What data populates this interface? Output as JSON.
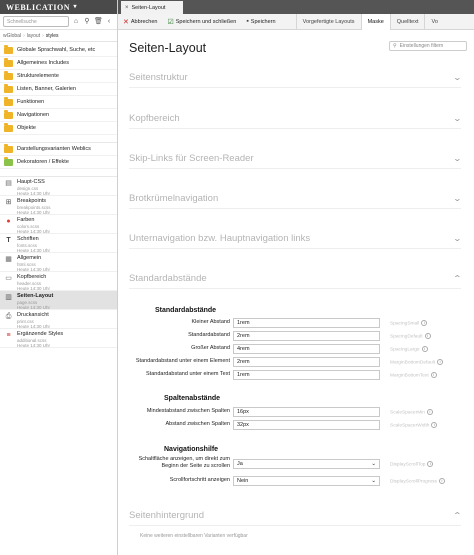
{
  "brand": {
    "name": "WEBLICATION"
  },
  "sidebar": {
    "search_placeholder": "Schnellsuche",
    "breadcrumb": [
      "wGlobal",
      "layout",
      "styles"
    ],
    "folders": [
      {
        "label": "Globale Sprachwahl, Suche, etc"
      },
      {
        "label": "Allgemeines Includes"
      },
      {
        "label": "Strukturelemente"
      },
      {
        "label": "Listen, Banner, Galerien"
      },
      {
        "label": "Funktionen"
      },
      {
        "label": "Navigationen"
      },
      {
        "label": "Objekte"
      },
      {
        "label": "Darstellungsvarianten Weblics"
      },
      {
        "label": "Dekoratoren / Effekte"
      }
    ],
    "files": [
      {
        "name": "Haupt-CSS",
        "file": "design.css",
        "date": "Heute 14:30 Uhr"
      },
      {
        "name": "Breakpoints",
        "file": "breakpoints.scss",
        "date": "Heute 14:30 Uhr"
      },
      {
        "name": "Farben",
        "file": "colors.scss",
        "date": "Heute 14:30 Uhr"
      },
      {
        "name": "Schriften",
        "file": "fonts.scss",
        "date": "Heute 14:30 Uhr"
      },
      {
        "name": "Allgemein",
        "file": "html.scss",
        "date": "Heute 14:30 Uhr"
      },
      {
        "name": "Kopfbereich",
        "file": "header.scss",
        "date": "Heute 14:30 Uhr"
      },
      {
        "name": "Seiten-Layout",
        "file": "page.scss",
        "date": "Heute 14:30 Uhr"
      },
      {
        "name": "Druckansicht",
        "file": "print.css",
        "date": "Heute 14:30 Uhr"
      },
      {
        "name": "Ergänzende Styles",
        "file": "additional.scss",
        "date": "Heute 14:30 Uhr"
      }
    ]
  },
  "tabbar": {
    "doc_tab": "Seiten-Layout"
  },
  "toolbar": {
    "cancel": "Abbrechen",
    "save_close": "Speichern und schließen",
    "save": "Speichern",
    "views": [
      "Vorgefertigte Layouts",
      "Maske",
      "Quelltext",
      "Vo"
    ]
  },
  "main": {
    "title": "Seiten-Layout",
    "filter_placeholder": "Einstellungen filtern",
    "sections": [
      "Seitenstruktur",
      "Kopfbereich",
      "Skip-Links für Screen-Reader",
      "Brotkrümelnavigation",
      "Unternavigation bzw. Hauptnavigation links",
      "Standardabstände",
      "Seitenhintergrund"
    ],
    "groups": {
      "standard": {
        "title": "Standardabstände",
        "rows": [
          {
            "label": "Kleiner Abstand",
            "value": "1rem",
            "var": "SpacingSmall"
          },
          {
            "label": "Standardabstand",
            "value": "2rem",
            "var": "SpacingDefault"
          },
          {
            "label": "Großer Abstand",
            "value": "4rem",
            "var": "SpacingLarge"
          },
          {
            "label": "Standardabstand unter einem Element",
            "value": "2rem",
            "var": "MarginBottomDefault"
          },
          {
            "label": "Standardabstand unter einem Text",
            "value": "1rem",
            "var": "MarginBottomText"
          }
        ]
      },
      "columns": {
        "title": "Spaltenabstände",
        "rows": [
          {
            "label": "Mindestabstand zwischen Spalten",
            "value": "16px",
            "var": "ScaleSpacerMin"
          },
          {
            "label": "Abstand zwischen Spalten",
            "value": "32px",
            "var": "ScaleSpacerWidth"
          }
        ]
      },
      "nav": {
        "title": "Navigationshilfe",
        "rows": [
          {
            "label_line1": "Schaltfläche anzeigen, um direkt zum",
            "label_line2": "Beginn der Seite zu scrollen",
            "value": "Ja",
            "var": "DisplayScrollTop"
          },
          {
            "label": "Scrollfortschritt anzeigen",
            "value": "Nein",
            "var": "DisplayScrollProgress"
          }
        ]
      }
    },
    "note": "Keine weiteren einstellbaren Varianten verfügbar"
  }
}
